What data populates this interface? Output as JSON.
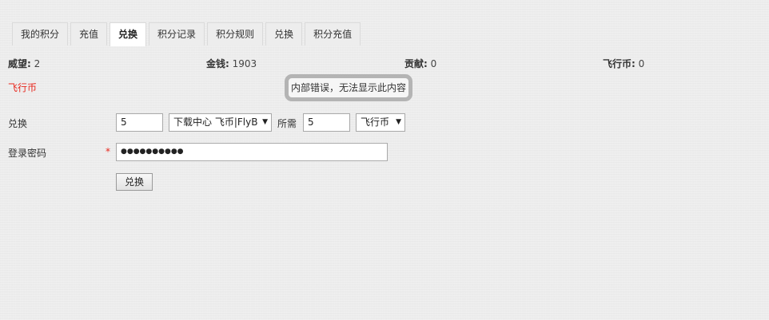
{
  "tabs": [
    {
      "label": "我的积分",
      "active": false
    },
    {
      "label": "充值",
      "active": false
    },
    {
      "label": "兑换",
      "active": true
    },
    {
      "label": "积分记录",
      "active": false
    },
    {
      "label": "积分规则",
      "active": false
    },
    {
      "label": "兑换",
      "active": false
    },
    {
      "label": "积分充值",
      "active": false
    }
  ],
  "stats": [
    {
      "key": "威望:",
      "value": "2"
    },
    {
      "key": "金钱:",
      "value": "1903"
    },
    {
      "key": "贡献:",
      "value": "0"
    },
    {
      "key": "飞行币:",
      "value": "0"
    }
  ],
  "currency_label": "飞行币",
  "error_message": "内部错误，无法显示此内容",
  "exchange": {
    "label": "兑换",
    "amount_value": "5",
    "source_select": "下载中心 飞币|FlyB",
    "required_label": "所需",
    "required_value": "5",
    "target_select": "飞行币"
  },
  "password": {
    "label": "登录密码",
    "required_mark": "*",
    "value": "●●●●●●●●●●"
  },
  "submit_label": "兑换",
  "colors": {
    "accent_red": "#e8281e",
    "background": "#ececec",
    "error_border": "#b4b4b4"
  }
}
